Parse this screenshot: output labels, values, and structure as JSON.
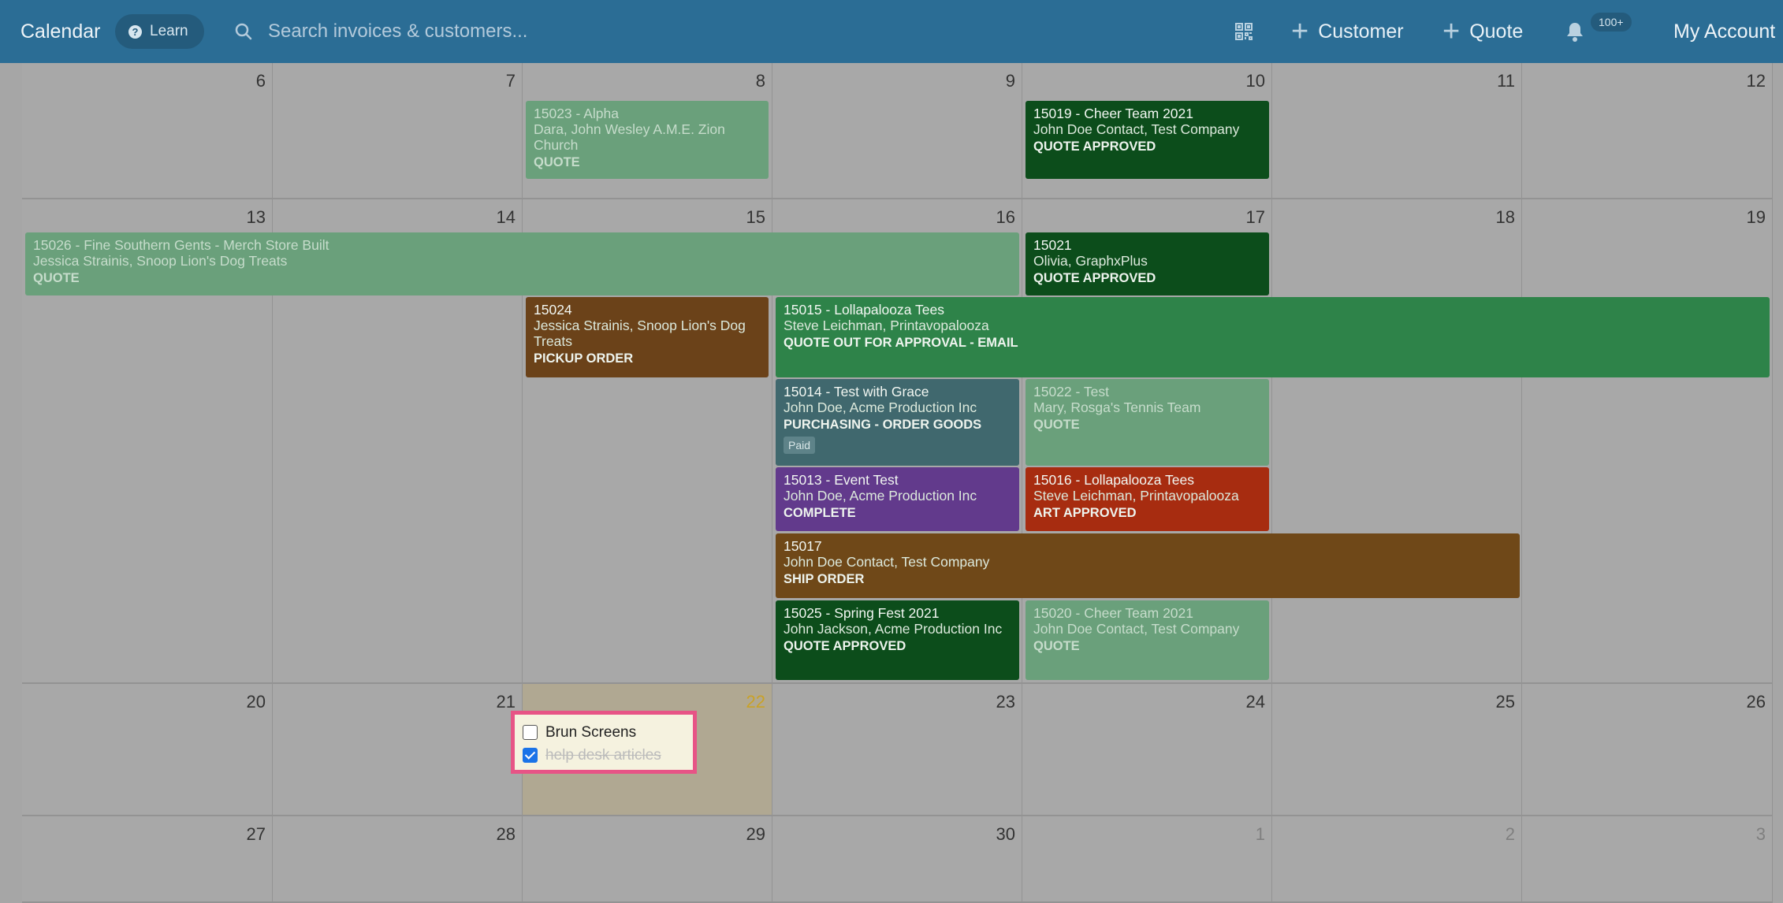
{
  "topbar": {
    "title": "Calendar",
    "learn_label": "Learn",
    "search_placeholder": "Search invoices & customers...",
    "add_customer_label": "Customer",
    "add_quote_label": "Quote",
    "notification_count": "100+",
    "account_label": "My Account"
  },
  "calendar": {
    "weeks": [
      [
        "6",
        "7",
        "8",
        "9",
        "10",
        "11",
        "12"
      ],
      [
        "13",
        "14",
        "15",
        "16",
        "17",
        "18",
        "19"
      ],
      [
        "20",
        "21",
        "22",
        "23",
        "24",
        "25",
        "26"
      ],
      [
        "27",
        "28",
        "29",
        "30",
        "1",
        "2",
        "3"
      ]
    ],
    "today": "22"
  },
  "events": [
    {
      "title": "15023 - Alpha",
      "customer": "Dara, John Wesley A.M.E. Zion Church",
      "status": "QUOTE"
    },
    {
      "title": "15019 - Cheer Team 2021",
      "customer": "John Doe Contact, Test Company",
      "status": "QUOTE APPROVED"
    },
    {
      "title": "15026 - Fine Southern Gents - Merch Store Built",
      "customer": "Jessica Strainis, Snoop Lion's Dog Treats",
      "status": "QUOTE"
    },
    {
      "title": "15021",
      "customer": "Olivia, GraphxPlus",
      "status": "QUOTE APPROVED"
    },
    {
      "title": "15024",
      "customer": "Jessica Strainis, Snoop Lion's Dog Treats",
      "status": "PICKUP ORDER"
    },
    {
      "title": "15015 - Lollapalooza Tees",
      "customer": "Steve Leichman, Printavopalooza",
      "status": "QUOTE OUT FOR APPROVAL - EMAIL"
    },
    {
      "title": "15014 - Test with Grace",
      "customer": "John Doe, Acme Production Inc",
      "status": "PURCHASING - ORDER GOODS",
      "badge": "Paid"
    },
    {
      "title": "15022 - Test",
      "customer": "Mary, Rosga's Tennis Team",
      "status": "QUOTE"
    },
    {
      "title": "15013 - Event Test",
      "customer": "John Doe, Acme Production Inc",
      "status": "COMPLETE"
    },
    {
      "title": "15016 - Lollapalooza Tees",
      "customer": "Steve Leichman, Printavopalooza",
      "status": "ART APPROVED"
    },
    {
      "title": "15017",
      "customer": "John Doe Contact, Test Company",
      "status": "SHIP ORDER"
    },
    {
      "title": "15025 - Spring Fest 2021",
      "customer": "John Jackson, Acme Production Inc",
      "status": "QUOTE APPROVED"
    },
    {
      "title": "15020 - Cheer Team 2021",
      "customer": "John Doe Contact, Test Company",
      "status": "QUOTE"
    }
  ],
  "todos": [
    {
      "label": "Brun Screens",
      "checked": false
    },
    {
      "label": "help desk articles",
      "checked": true
    }
  ]
}
